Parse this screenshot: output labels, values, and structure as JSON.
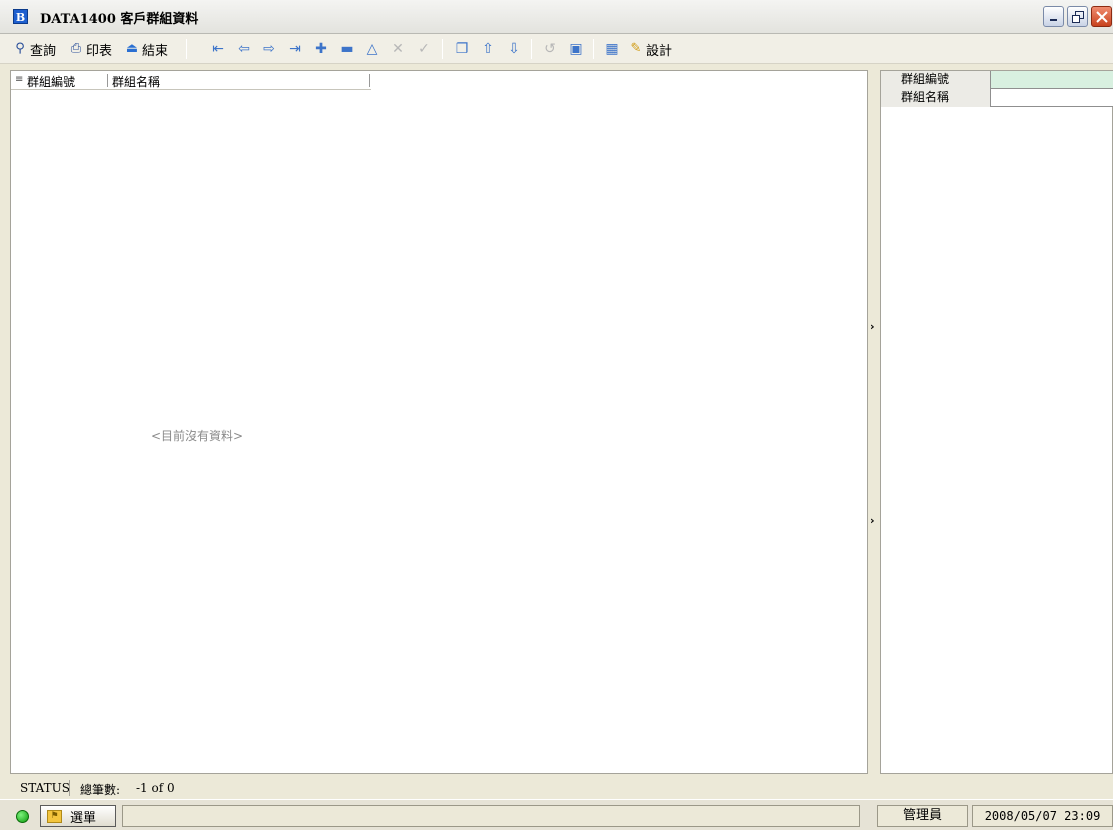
{
  "window": {
    "icon_letter": "B",
    "title": "DATA1400 客戶群組資料",
    "icons": [
      "minimize-icon",
      "restore-icon",
      "close-icon"
    ]
  },
  "toolbar": {
    "query_label": "查詢",
    "print_label": "印表",
    "exit_label": "結束",
    "design_label": "設計",
    "nav_icons": [
      "first-record-icon",
      "prev-record-icon",
      "next-record-icon",
      "last-record-icon",
      "add-record-icon",
      "delete-record-icon",
      "edit-record-icon",
      "cancel-icon",
      "confirm-icon",
      "copy-icon",
      "move-up-icon",
      "move-down-icon",
      "refresh-icon",
      "sql-icon",
      "export-icon",
      "design-icon"
    ]
  },
  "grid": {
    "columns": [
      "群組編號",
      "群組名稱"
    ],
    "empty_message": "<目前沒有資料>"
  },
  "form": {
    "fields": [
      {
        "label": "群組編號",
        "value": ""
      },
      {
        "label": "群組名稱",
        "value": ""
      }
    ]
  },
  "status": {
    "label": "STATUS",
    "count_label": "總筆數:",
    "count_value": "-1 of 0"
  },
  "taskbar": {
    "menu_label": "選單",
    "user": "管理員",
    "datetime": "2008/05/07 23:09"
  }
}
